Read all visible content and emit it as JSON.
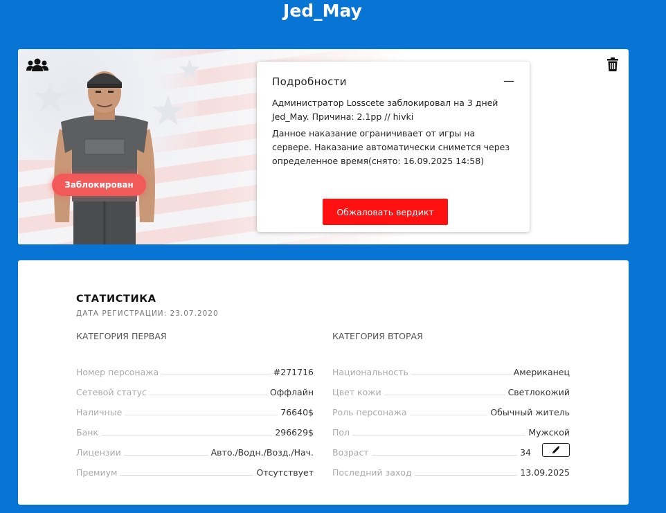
{
  "header": {
    "title": "Jed_May"
  },
  "profile": {
    "status_badge": "Заблокирован"
  },
  "details": {
    "title": "Подробности",
    "collapse_symbol": "—",
    "line1": "Администратор Losscete заблокировал на 3 дней Jed_May. Причина: 2.1pp // hivki",
    "line2": "Данное наказание ограничивает от игры на сервере. Наказание автоматически снимется через определенное время(снято: 16.09.2025 14:58)",
    "appeal_label": "Обжаловать вердикт"
  },
  "stats": {
    "title": "СТАТИСТИКА",
    "registration": "ДАТА РЕГИСТРАЦИИ: 23.07.2020",
    "left": {
      "heading": "КАТЕГОРИЯ ПЕРВАЯ",
      "rows": [
        {
          "label": "Номер персонажа",
          "value": "#271716"
        },
        {
          "label": "Сетевой статус",
          "value": "Оффлайн"
        },
        {
          "label": "Наличные",
          "value": "76640$"
        },
        {
          "label": "Банк",
          "value": "296629$"
        },
        {
          "label": "Лицензии",
          "value": "Авто./Водн./Возд./Нач."
        },
        {
          "label": "Премиум",
          "value": "Отсутствует"
        }
      ]
    },
    "right": {
      "heading": "КАТЕГОРИЯ ВТОРАЯ",
      "rows": [
        {
          "label": "Национальность",
          "value": "Американец"
        },
        {
          "label": "Цвет кожи",
          "value": "Светлокожий"
        },
        {
          "label": "Роль персонажа",
          "value": "Обычный житель"
        },
        {
          "label": "Пол",
          "value": "Мужской"
        },
        {
          "label": "Возраст",
          "value": "34"
        },
        {
          "label": "Последний заход",
          "value": "13.09.2025"
        }
      ]
    }
  },
  "colors": {
    "page_bg": "#0874d4",
    "badge": "#f25a5a",
    "appeal_button": "#ff1111"
  },
  "icons": {
    "group": "users-group-icon",
    "trash": "trash-icon",
    "edit": "pencil-icon"
  }
}
